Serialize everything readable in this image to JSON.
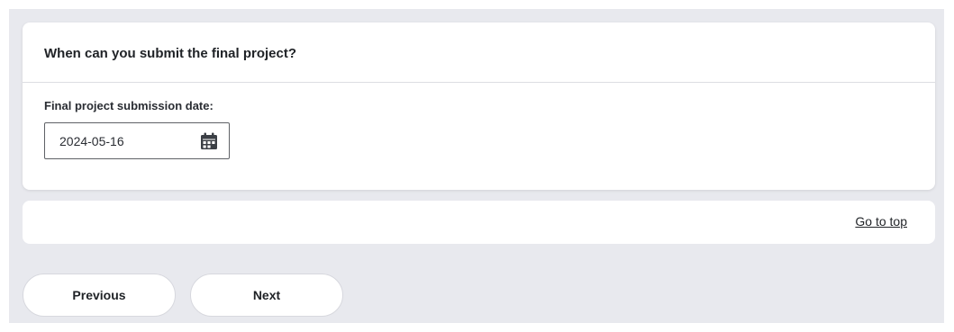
{
  "question": {
    "title": "When can you submit the final project?",
    "field_label": "Final project submission date:",
    "date_value": "2024-05-16",
    "calendar_icon": "calendar-icon"
  },
  "footer": {
    "go_to_top": "Go to top"
  },
  "nav": {
    "previous_label": "Previous",
    "next_label": "Next"
  },
  "colors": {
    "page_background": "#e8e9ee",
    "card_background": "#ffffff",
    "text": "#1f2226",
    "icon": "#3b3f45"
  }
}
